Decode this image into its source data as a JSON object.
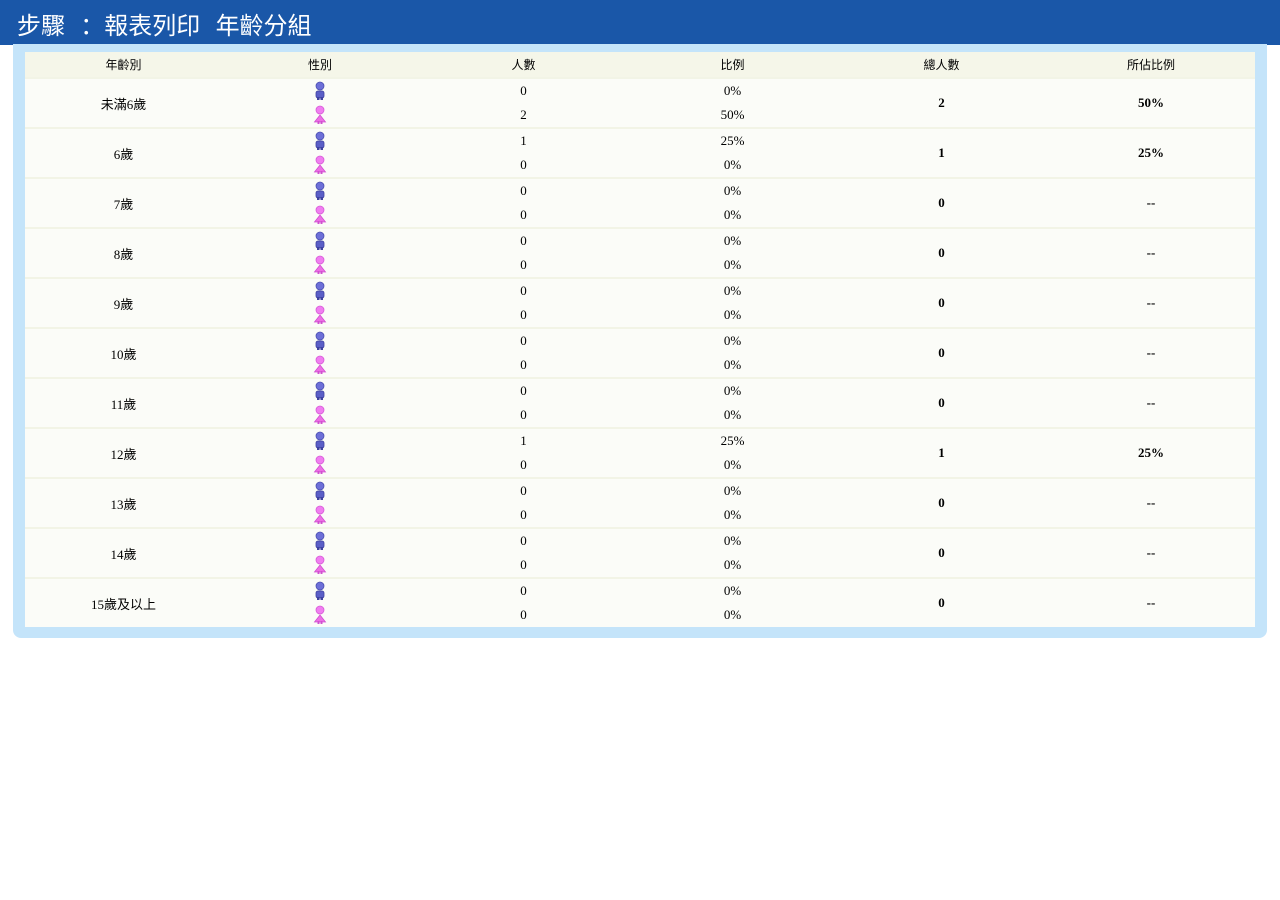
{
  "header": {
    "title_prefix": "步驟",
    "title_glyph1": "",
    "title_colon": "：報表列印",
    "title_glyph2": "",
    "title_suffix": "年齡分組"
  },
  "table": {
    "columns": [
      "年齡別",
      "性別",
      "人數",
      "比例",
      "總人數",
      "所佔比例"
    ],
    "gender_icons": {
      "male": "male-person-icon",
      "female": "female-person-icon"
    },
    "colors": {
      "male": "#5b5fc7",
      "female": "#ee6ee6",
      "header_bg": "#f5f6e9",
      "title_bg": "#1a57a8",
      "panel_bg": "#c4e4fa"
    },
    "rows": [
      {
        "age": "未滿6歲",
        "male_count": "0",
        "male_ratio": "0%",
        "female_count": "2",
        "female_ratio": "50%",
        "total": "2",
        "share": "50%"
      },
      {
        "age": "6歲",
        "male_count": "1",
        "male_ratio": "25%",
        "female_count": "0",
        "female_ratio": "0%",
        "total": "1",
        "share": "25%"
      },
      {
        "age": "7歲",
        "male_count": "0",
        "male_ratio": "0%",
        "female_count": "0",
        "female_ratio": "0%",
        "total": "0",
        "share": "--"
      },
      {
        "age": "8歲",
        "male_count": "0",
        "male_ratio": "0%",
        "female_count": "0",
        "female_ratio": "0%",
        "total": "0",
        "share": "--"
      },
      {
        "age": "9歲",
        "male_count": "0",
        "male_ratio": "0%",
        "female_count": "0",
        "female_ratio": "0%",
        "total": "0",
        "share": "--"
      },
      {
        "age": "10歲",
        "male_count": "0",
        "male_ratio": "0%",
        "female_count": "0",
        "female_ratio": "0%",
        "total": "0",
        "share": "--"
      },
      {
        "age": "11歲",
        "male_count": "0",
        "male_ratio": "0%",
        "female_count": "0",
        "female_ratio": "0%",
        "total": "0",
        "share": "--"
      },
      {
        "age": "12歲",
        "male_count": "1",
        "male_ratio": "25%",
        "female_count": "0",
        "female_ratio": "0%",
        "total": "1",
        "share": "25%"
      },
      {
        "age": "13歲",
        "male_count": "0",
        "male_ratio": "0%",
        "female_count": "0",
        "female_ratio": "0%",
        "total": "0",
        "share": "--"
      },
      {
        "age": "14歲",
        "male_count": "0",
        "male_ratio": "0%",
        "female_count": "0",
        "female_ratio": "0%",
        "total": "0",
        "share": "--"
      },
      {
        "age": "15歲及以上",
        "male_count": "0",
        "male_ratio": "0%",
        "female_count": "0",
        "female_ratio": "0%",
        "total": "0",
        "share": "--"
      }
    ]
  }
}
